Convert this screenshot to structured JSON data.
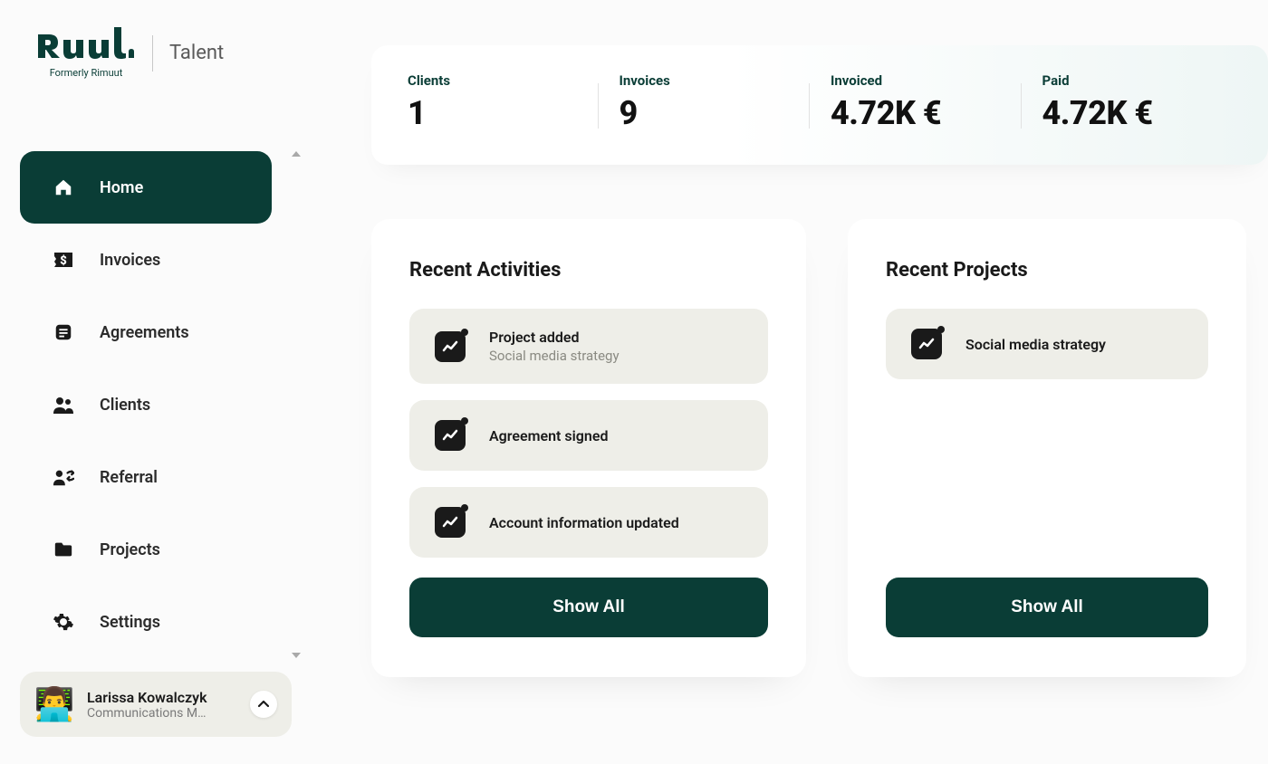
{
  "brand": {
    "logo_text": "Ruul",
    "sub": "Formerly Rimuut",
    "product": "Talent"
  },
  "sidebar": {
    "items": [
      {
        "label": "Home",
        "icon": "home-icon",
        "active": true
      },
      {
        "label": "Invoices",
        "icon": "invoice-icon",
        "active": false
      },
      {
        "label": "Agreements",
        "icon": "document-icon",
        "active": false
      },
      {
        "label": "Clients",
        "icon": "people-icon",
        "active": false
      },
      {
        "label": "Referral",
        "icon": "referral-icon",
        "active": false
      },
      {
        "label": "Projects",
        "icon": "folder-icon",
        "active": false
      },
      {
        "label": "Settings",
        "icon": "gear-icon",
        "active": false
      }
    ]
  },
  "profile": {
    "name": "Larissa Kowalczyk",
    "role": "Communications M…",
    "avatar_emoji": "👨‍💻"
  },
  "stats": [
    {
      "label": "Clients",
      "value": "1"
    },
    {
      "label": "Invoices",
      "value": "9"
    },
    {
      "label": "Invoiced",
      "value": "4.72K €"
    },
    {
      "label": "Paid",
      "value": "4.72K €"
    }
  ],
  "activities": {
    "title": "Recent Activities",
    "items": [
      {
        "title": "Project added",
        "sub": "Social media strategy"
      },
      {
        "title": "Agreement signed",
        "sub": ""
      },
      {
        "title": "Account information updated",
        "sub": ""
      }
    ],
    "show_all": "Show All"
  },
  "projects": {
    "title": "Recent Projects",
    "items": [
      {
        "title": "Social media strategy"
      }
    ],
    "show_all": "Show All"
  }
}
